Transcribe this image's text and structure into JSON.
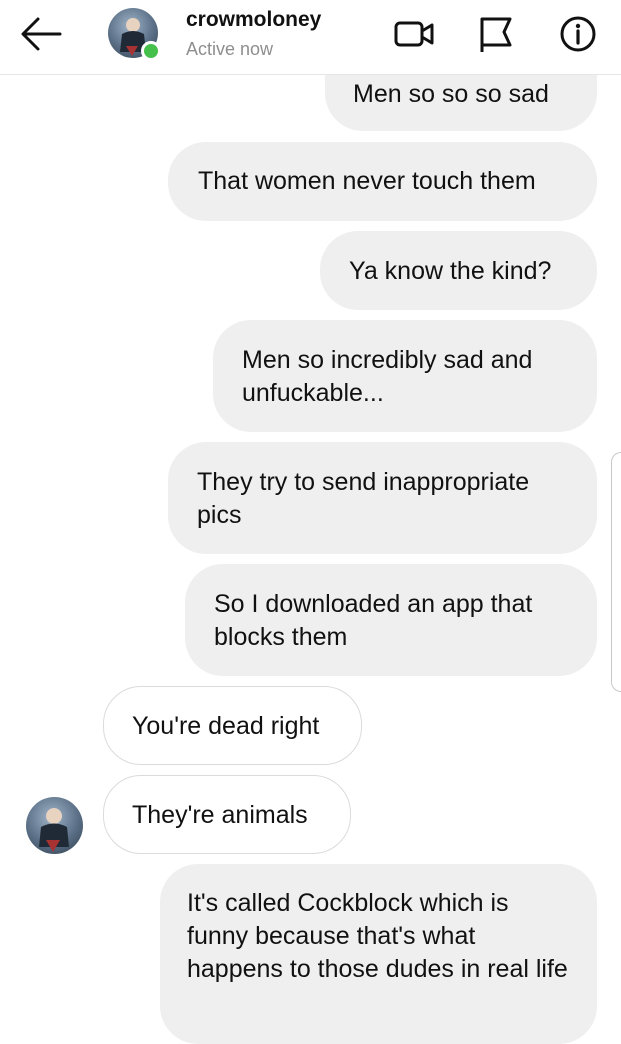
{
  "header": {
    "username": "crowmoloney",
    "status": "Active now",
    "icons": {
      "back": "back-arrow-icon",
      "video": "video-camera-icon",
      "flag": "flag-icon",
      "info": "info-icon"
    },
    "online_color": "#44c04b"
  },
  "messages": [
    {
      "direction": "sent",
      "text": "Men so so so sad"
    },
    {
      "direction": "sent",
      "text": "That women never touch them"
    },
    {
      "direction": "sent",
      "text": "Ya know the kind?"
    },
    {
      "direction": "sent",
      "text": "Men so incredibly sad and unfuckable..."
    },
    {
      "direction": "sent",
      "text": "They try to send inappropriate pics"
    },
    {
      "direction": "sent",
      "text": "So I downloaded an app that blocks them"
    },
    {
      "direction": "received",
      "text": "You're dead right"
    },
    {
      "direction": "received",
      "text": "They're animals"
    },
    {
      "direction": "sent",
      "text": "It's called Cockblock which is funny because that's what happens to those dudes in real life"
    }
  ],
  "colors": {
    "sent_bubble": "#efefef",
    "received_border": "#dbdbdb",
    "secondary_text": "#8e8e8e"
  }
}
